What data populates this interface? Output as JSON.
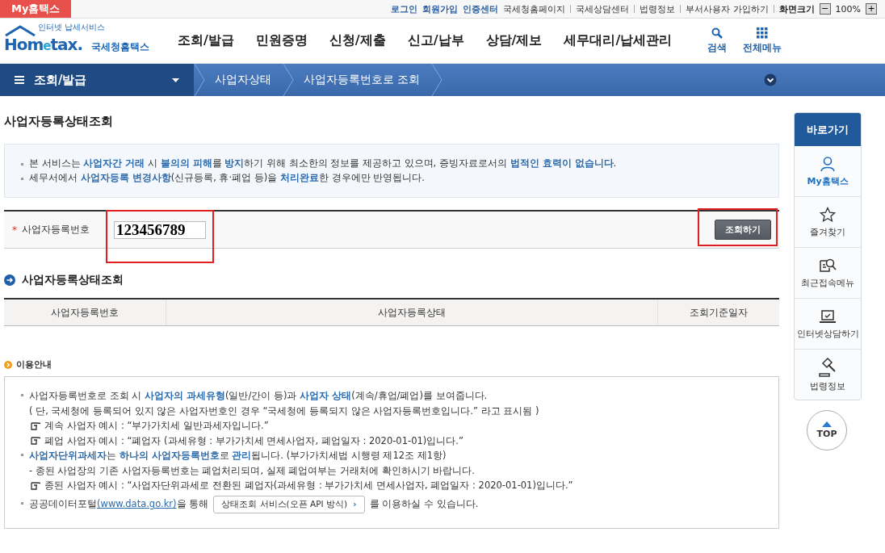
{
  "top_bar": {
    "my_tab": "My홈택스",
    "links": [
      {
        "label": "로그인",
        "kind": "primary"
      },
      {
        "label": "회원가입",
        "kind": "primary"
      },
      {
        "label": "인증센터",
        "kind": "primary"
      },
      {
        "label": "국세청홈페이지",
        "kind": "plain"
      },
      {
        "label": "국세상담센터",
        "kind": "plain"
      },
      {
        "label": "법령정보",
        "kind": "plain"
      },
      {
        "label": "부서사용자 가입하기",
        "kind": "plain"
      }
    ],
    "zoom_label": "화면크기",
    "zoom_minus": "−",
    "zoom_value": "100%",
    "zoom_plus": "+"
  },
  "header": {
    "logo_tagline": "인터넷 납세서비스",
    "logo_main": "Hom",
    "logo_e": "e",
    "logo_tax": "tax.",
    "logo_sub": "국세청홈택스",
    "menu": [
      "조회/발급",
      "민원증명",
      "신청/제출",
      "신고/납부",
      "상담/제보",
      "세무대리/납세관리"
    ],
    "search": "검색",
    "all_menu": "전체메뉴"
  },
  "nav": {
    "category": "조회/발급",
    "crumbs": [
      "사업자상태",
      "사업자등록번호로 조회"
    ]
  },
  "page_title": "사업자등록상태조회",
  "notice_top": [
    "본 서비스는 **사업자간 거래** 시 **불의의 피해**를 **방지**하기 위해 최소한의 정보를 제공하고 있으며, 증빙자료로서의 **법적인 효력이 없습니다**.",
    "세무서에서 **사업자등록 변경사항**(신규등록, 휴·폐업 등)을 **처리완료**한 경우에만 반영됩니다."
  ],
  "search": {
    "required_mark": "*",
    "label": "사업자등록번호",
    "value": "123456789",
    "field_highlighted": true,
    "button": "조회하기",
    "button_highlighted": true
  },
  "result": {
    "title": "사업자등록상태조회",
    "columns": [
      "사업자등록번호",
      "사업자등록상태",
      "조회기준일자"
    ]
  },
  "guide": {
    "title": "이용안내",
    "items": [
      {
        "kind": "bullet",
        "text": "사업자등록번호로 조회 시 **사업자의 과세유형**(일반/간이 등)과 **사업자 상태**(계속/휴업/폐업)를 보여줍니다."
      },
      {
        "kind": "sub",
        "text": "( 단, 국세청에 등록되어 있지 않은 사업자번호인 경우 “국세청에 등록되지 않은 사업자등록번호입니다.” 라고 표시됨 )"
      },
      {
        "kind": "example",
        "text": "계속 사업자 예시 : “부가가치세 일반과세자입니다.”"
      },
      {
        "kind": "example",
        "text": "폐업 사업자 예시 : “폐업자 (과세유형 : 부가가치세 면세사업자, 폐업일자 : 2020-01-01)입니다.”"
      },
      {
        "kind": "bullet",
        "text": "**사업자단위과세자**는 **하나의 사업자등록번호**로 **관리**됩니다. (부가가치세법 시행령 제12조 제1항)"
      },
      {
        "kind": "sub",
        "text": "- 종된 사업장의 기존 사업자등록번호는 폐업처리되며, 실제 폐업여부는 거래처에 확인하시기 바랍니다."
      },
      {
        "kind": "example",
        "text": "종된 사업자 예시 : “사업자단위과세로 전환된 폐업자(과세유형 : 부가가치세 면세사업자, 폐업일자 : 2020-01-01)입니다.”"
      },
      {
        "kind": "portal",
        "before": "공공데이터포털",
        "link": "(www.data.go.kr)",
        "middle": "을 통해",
        "button": "상태조회 서비스(오픈 API 방식)",
        "button_arrow": "›",
        "after": "를 이용하실 수 있습니다."
      }
    ]
  },
  "quick": {
    "title": "바로가기",
    "items": [
      {
        "label": "My홈택스",
        "selected": true
      },
      {
        "label": "즐겨찾기",
        "selected": false
      },
      {
        "label": "최근접속메뉴",
        "selected": false
      },
      {
        "label": "인터넷상담하기",
        "selected": false
      },
      {
        "label": "법령정보",
        "selected": false
      }
    ],
    "top": "TOP"
  }
}
